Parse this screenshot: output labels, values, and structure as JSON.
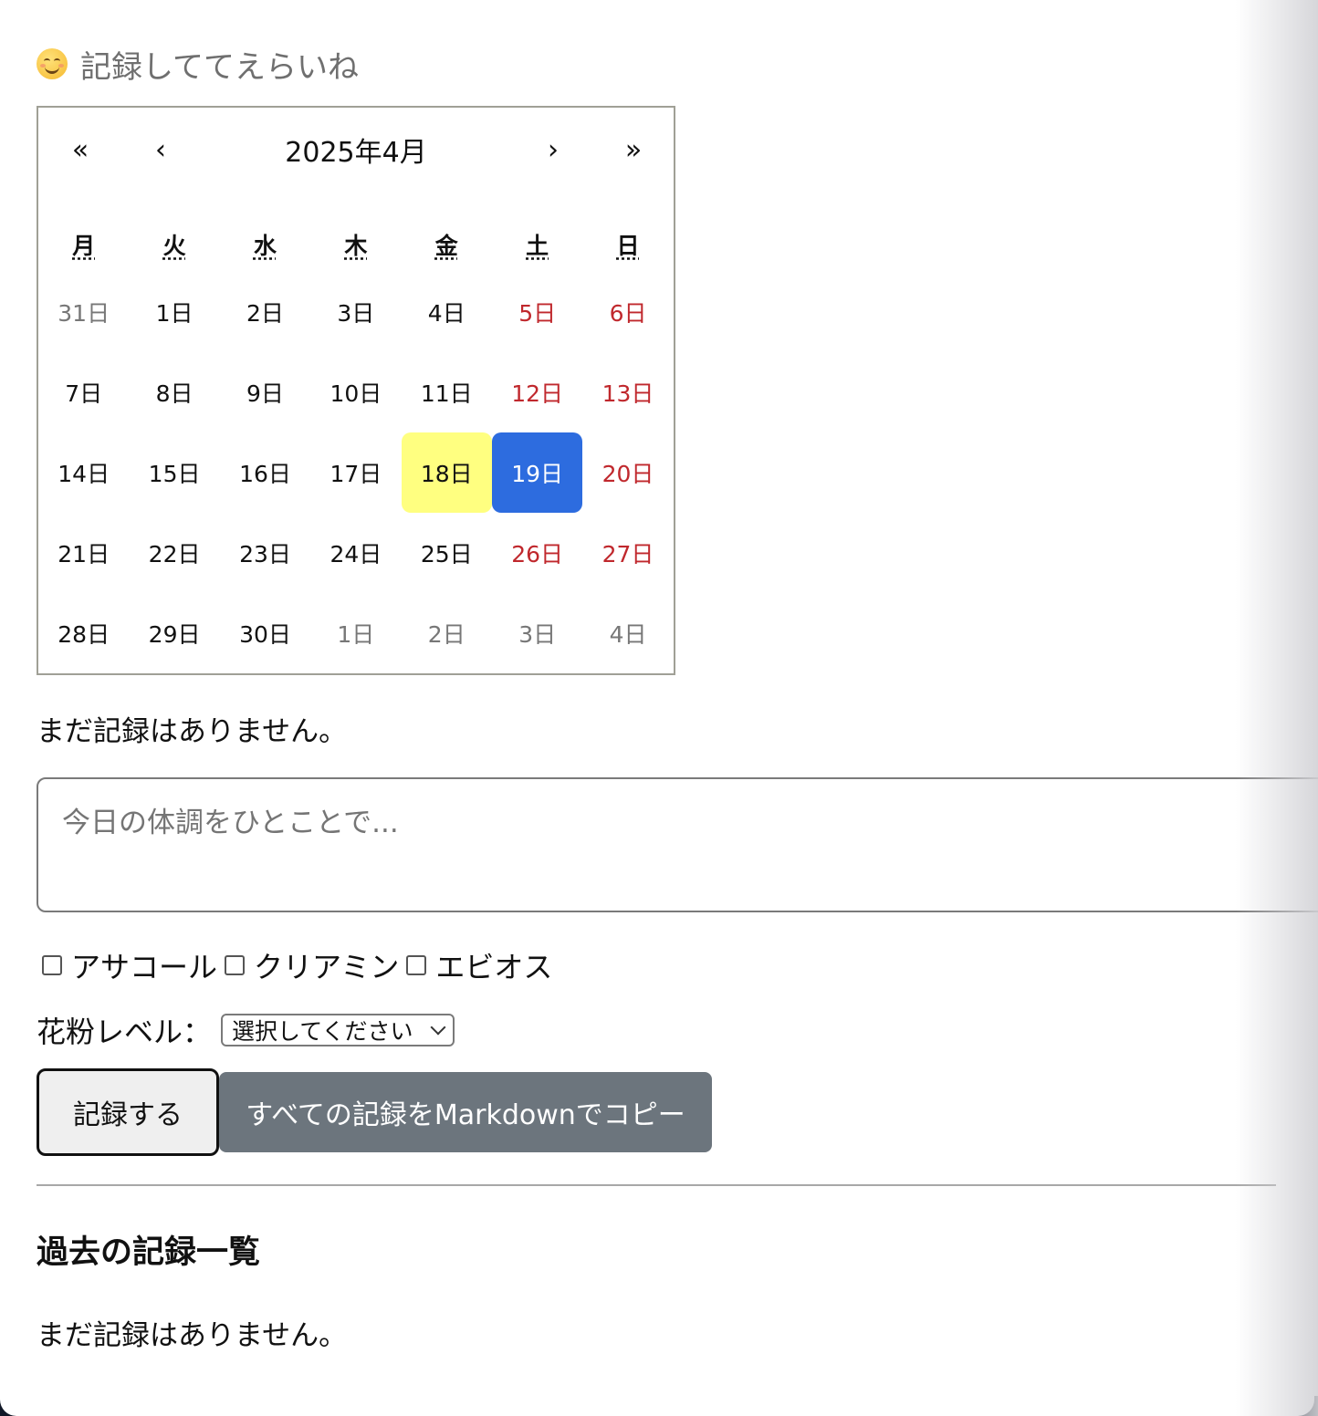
{
  "greeting": {
    "icon": "smiling-face-icon",
    "text": "記録しててえらいね"
  },
  "calendar": {
    "nav": {
      "prev_year": "«",
      "prev_month": "‹",
      "label": "2025年4月",
      "next_month": "›",
      "next_year": "»"
    },
    "weekdays": [
      "月",
      "火",
      "水",
      "木",
      "金",
      "土",
      "日"
    ],
    "days": [
      {
        "label": "31日",
        "state": "neighbor"
      },
      {
        "label": "1日",
        "state": ""
      },
      {
        "label": "2日",
        "state": ""
      },
      {
        "label": "3日",
        "state": ""
      },
      {
        "label": "4日",
        "state": ""
      },
      {
        "label": "5日",
        "state": "weekend"
      },
      {
        "label": "6日",
        "state": "weekend"
      },
      {
        "label": "7日",
        "state": ""
      },
      {
        "label": "8日",
        "state": ""
      },
      {
        "label": "9日",
        "state": ""
      },
      {
        "label": "10日",
        "state": ""
      },
      {
        "label": "11日",
        "state": ""
      },
      {
        "label": "12日",
        "state": "weekend"
      },
      {
        "label": "13日",
        "state": "weekend"
      },
      {
        "label": "14日",
        "state": ""
      },
      {
        "label": "15日",
        "state": ""
      },
      {
        "label": "16日",
        "state": ""
      },
      {
        "label": "17日",
        "state": ""
      },
      {
        "label": "18日",
        "state": "today"
      },
      {
        "label": "19日",
        "state": "selected"
      },
      {
        "label": "20日",
        "state": "weekend"
      },
      {
        "label": "21日",
        "state": ""
      },
      {
        "label": "22日",
        "state": ""
      },
      {
        "label": "23日",
        "state": ""
      },
      {
        "label": "24日",
        "state": ""
      },
      {
        "label": "25日",
        "state": ""
      },
      {
        "label": "26日",
        "state": "weekend"
      },
      {
        "label": "27日",
        "state": "weekend"
      },
      {
        "label": "28日",
        "state": ""
      },
      {
        "label": "29日",
        "state": ""
      },
      {
        "label": "30日",
        "state": ""
      },
      {
        "label": "1日",
        "state": "neighbor"
      },
      {
        "label": "2日",
        "state": "neighbor"
      },
      {
        "label": "3日",
        "state": "neighbor"
      },
      {
        "label": "4日",
        "state": "neighbor"
      }
    ],
    "colors": {
      "today": "#ffff80",
      "selected": "#2d6cdf",
      "weekend": "#c0282d"
    }
  },
  "status": {
    "no_records": "まだ記録はありません。"
  },
  "memo": {
    "placeholder": "今日の体調をひとことで...",
    "value": ""
  },
  "medications": [
    {
      "label": "アサコール",
      "checked": false
    },
    {
      "label": "クリアミン",
      "checked": false
    },
    {
      "label": "エビオス",
      "checked": false
    }
  ],
  "pollen": {
    "label": "花粉レベル：",
    "selected": "選択してください"
  },
  "buttons": {
    "record": "記録する",
    "copy_markdown": "すべての記録をMarkdownでコピー",
    "copy_color": "#6c757d"
  },
  "history": {
    "title": "過去の記録一覧",
    "empty": "まだ記録はありません。"
  }
}
